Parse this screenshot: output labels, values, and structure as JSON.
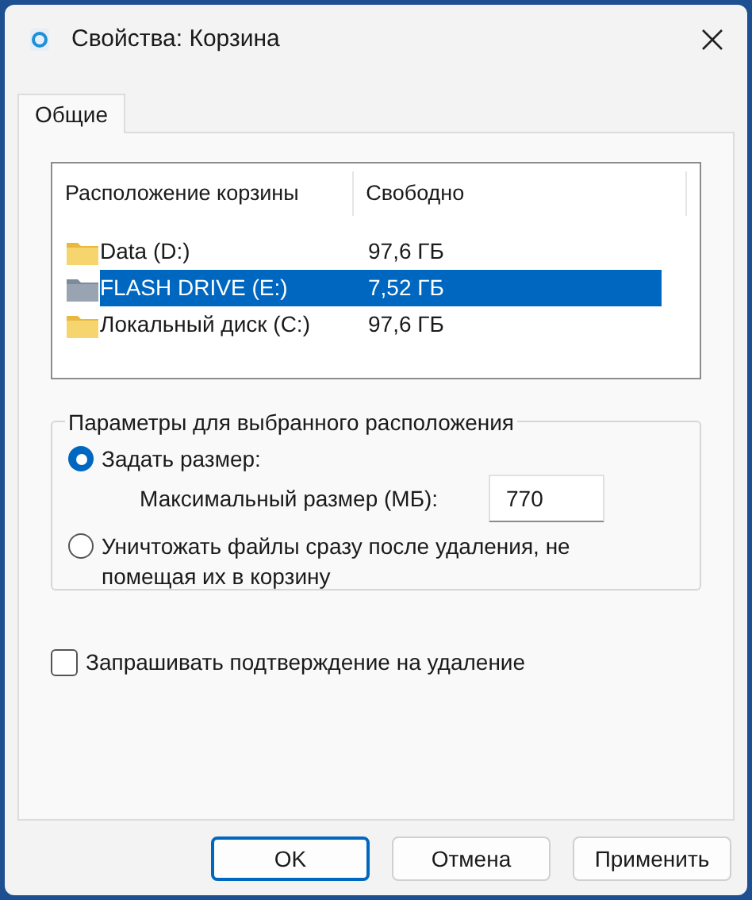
{
  "window": {
    "title": "Свойства: Корзина"
  },
  "tabs": [
    {
      "label": "Общие",
      "selected": true
    }
  ],
  "locations": {
    "columns": [
      "Расположение корзины",
      "Свободно"
    ],
    "rows": [
      {
        "name": "Data (D:)",
        "free": "97,6 ГБ",
        "kind": "folder",
        "selected": false
      },
      {
        "name": "FLASH DRIVE (E:)",
        "free": "7,52 ГБ",
        "kind": "removable",
        "selected": true
      },
      {
        "name": "Локальный диск (C:)",
        "free": "97,6 ГБ",
        "kind": "folder",
        "selected": false
      }
    ]
  },
  "settings": {
    "title": "Параметры для выбранного расположения",
    "options": [
      {
        "label": "Задать размер:",
        "selected": true,
        "field": {
          "label": "Максимальный размер (МБ):",
          "value": "770"
        }
      },
      {
        "label": "Уничтожать файлы сразу после удаления, не помещая их в корзину",
        "selected": false
      }
    ]
  },
  "confirm": {
    "label": "Запрашивать подтверждение на удаление",
    "checked": false
  },
  "buttons": [
    {
      "label": "OK",
      "default": true
    },
    {
      "label": "Отмена",
      "default": false
    },
    {
      "label": "Применить",
      "default": false
    }
  ]
}
